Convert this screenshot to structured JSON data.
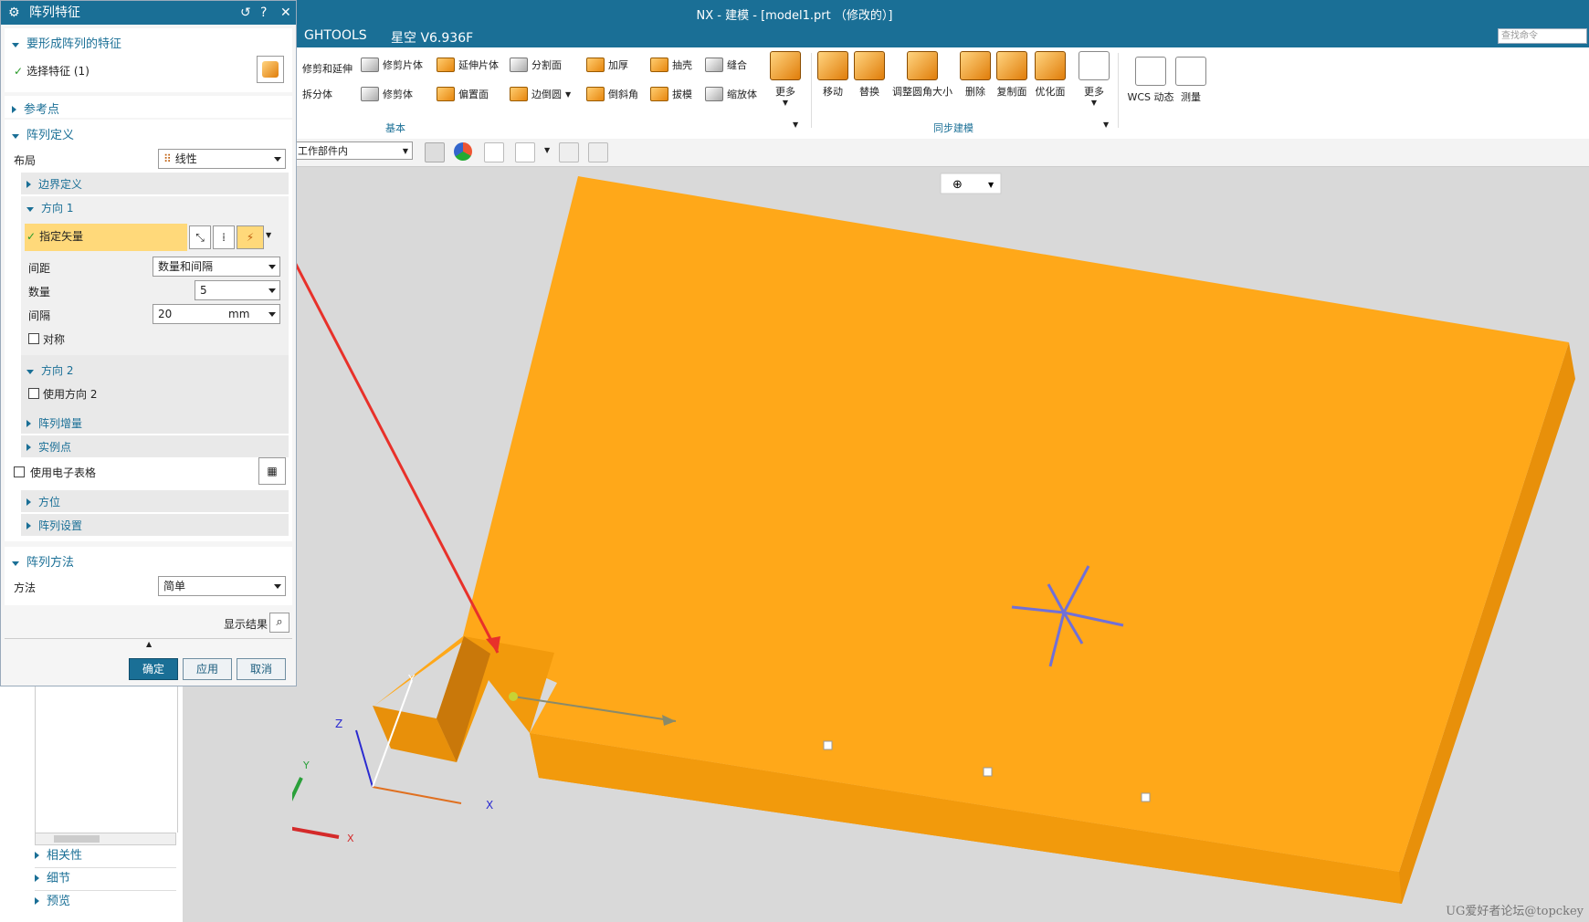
{
  "window": {
    "title": "NX - 建模 - [model1.prt （修改的）]",
    "tabs": [
      "GHTOOLS",
      "星空 V6.936F"
    ],
    "search_placeholder": "查找命令"
  },
  "ribbon": {
    "basic_small": [
      "修剪和延伸",
      "修剪片体",
      "延伸片体",
      "分割面",
      "加厚",
      "抽壳",
      "缝合",
      "拆分体",
      "修剪体",
      "偏置面",
      "边倒圆",
      "倒斜角",
      "拔模",
      "缩放体"
    ],
    "basic_more": "更多",
    "basic_group": "基本",
    "sync_buttons": [
      "移动",
      "替换",
      "调整圆角大小",
      "删除",
      "复制面",
      "优化面",
      "更多"
    ],
    "sync_group": "同步建模",
    "other_buttons": [
      "WCS 动态",
      "测量"
    ]
  },
  "toolbar2": {
    "filter_value": "工作部件内"
  },
  "dialog": {
    "title": "阵列特征",
    "features_section": "要形成阵列的特征",
    "select_feature": "选择特征 (1)",
    "reference_point": "参考点",
    "array_definition": "阵列定义",
    "layout_label": "布局",
    "layout_value": "线性",
    "boundary_def": "边界定义",
    "direction1": "方向 1",
    "specify_vector": "指定矢量",
    "spacing_label": "间距",
    "spacing_value": "数量和间隔",
    "count_label": "数量",
    "count_value": "5",
    "pitch_label": "间隔",
    "pitch_value": "20",
    "pitch_unit": "mm",
    "symmetric": "对称",
    "direction2": "方向 2",
    "use_direction2": "使用方向 2",
    "array_increment": "阵列增量",
    "instance_points": "实例点",
    "use_spreadsheet": "使用电子表格",
    "orientation": "方位",
    "array_settings": "阵列设置",
    "array_method": "阵列方法",
    "method_label": "方法",
    "method_value": "简单",
    "show_result": "显示结果",
    "ok": "确定",
    "apply": "应用",
    "cancel": "取消"
  },
  "nav_panel": {
    "items": [
      "相关性",
      "细节",
      "预览"
    ]
  },
  "viewport": {
    "axis_labels": [
      "X",
      "Y",
      "Z",
      "X",
      "Y",
      "Z"
    ]
  },
  "watermark": "UG爱好者论坛@topckey",
  "colors": {
    "accent": "#1a6f96",
    "model_top": "#ffa819",
    "model_side": "#e8900a",
    "arrow": "#e8312a"
  }
}
